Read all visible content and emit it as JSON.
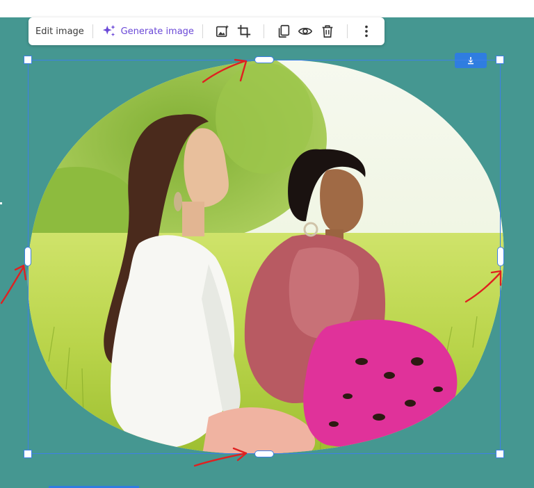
{
  "toolbar": {
    "edit_label": "Edit image",
    "generate_label": "Generate image",
    "icons": [
      "sparkle-icon",
      "image-edit-icon",
      "crop-icon",
      "duplicate-icon",
      "eye-icon",
      "trash-icon",
      "more-vertical-icon"
    ]
  },
  "canvas": {
    "background_color": "#459791",
    "selection_color": "#3d7fe6",
    "annotation_color": "#e02020",
    "toolbar_accent": "#6a48d7",
    "download_button_color": "#2f7de0"
  },
  "image": {
    "description_icon": "photo-two-women-in-meadow",
    "download_icon": "download-icon"
  }
}
